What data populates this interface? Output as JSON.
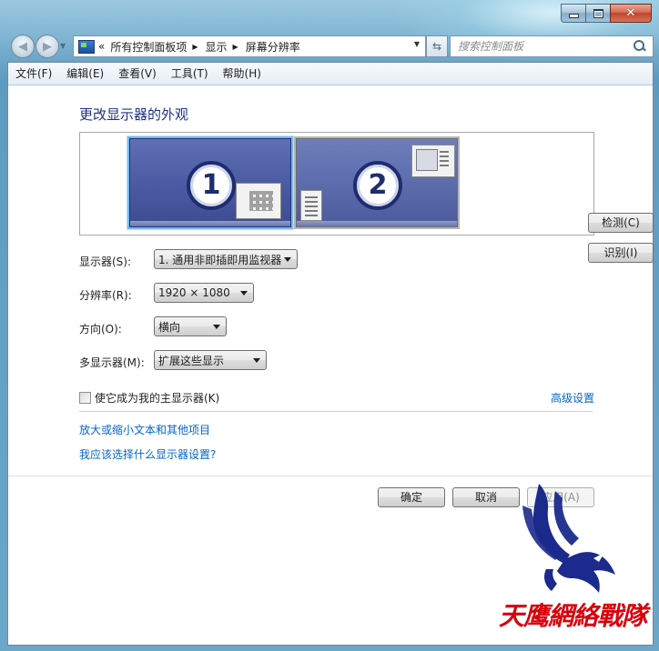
{
  "window": {
    "caption": {
      "minimize": "–",
      "maximize": "□",
      "close": "✕"
    }
  },
  "address": {
    "overflow": "«",
    "segments": [
      "所有控制面板项",
      "显示",
      "屏幕分辨率"
    ],
    "search_placeholder": "搜索控制面板"
  },
  "menubar": {
    "items": [
      "文件(F)",
      "编辑(E)",
      "查看(V)",
      "工具(T)",
      "帮助(H)"
    ]
  },
  "main": {
    "title": "更改显示器的外观",
    "monitors": [
      {
        "number": "1",
        "selected": true
      },
      {
        "number": "2",
        "selected": false
      }
    ],
    "detect_label": "检测(C)",
    "identify_label": "识别(I)",
    "fields": {
      "display": {
        "label": "显示器(S):",
        "value": "1. 通用非即插即用监视器"
      },
      "resolution": {
        "label": "分辨率(R):",
        "value": "1920 × 1080"
      },
      "orientation": {
        "label": "方向(O):",
        "value": "横向"
      },
      "multi": {
        "label": "多显示器(M):",
        "value": "扩展这些显示"
      }
    },
    "primary_checkbox_label": "使它成为我的主显示器(K)",
    "primary_checked": false,
    "advanced_link": "高级设置",
    "link_zoom": "放大或缩小文本和其他项目",
    "link_help": "我应该选择什么显示器设置?"
  },
  "buttons": {
    "ok": "确定",
    "cancel": "取消",
    "apply": "应用(A)"
  },
  "watermark": {
    "text": "天鹰網絡戰隊",
    "color": "#d9000b",
    "eagle_color": "#1b2a8c"
  }
}
